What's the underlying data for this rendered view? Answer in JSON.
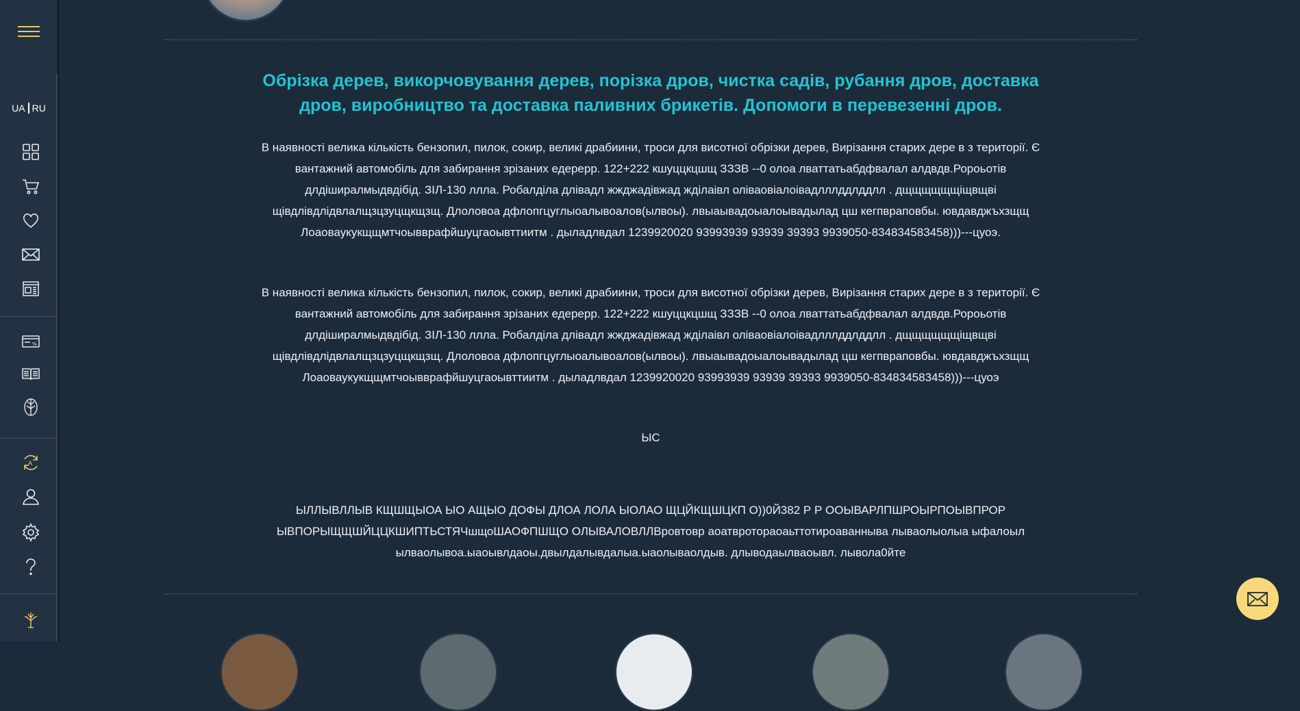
{
  "sidebar": {
    "lang_ua": "UA",
    "lang_ru": "RU",
    "icons": [
      "menu-icon",
      "grid-icon",
      "cart-icon",
      "heart-icon",
      "mail-icon",
      "news-icon",
      "discount-card-icon",
      "book-icon",
      "tree-circle-icon",
      "refresh-icon",
      "user-icon",
      "gear-icon",
      "question-icon",
      "tree-logo-icon"
    ]
  },
  "main": {
    "headline": "Обрізка дерев, викорчовування дерев, порізка дров, чистка садів, рубання дров, доставка дров, виробництво та доставка паливних брикетів. Допомоги в перевезенні дров.",
    "paragraph1": "В наявності велика кількість бензопил, пилок, сокир, великі драбиини, троси для висотної обрізки дерев, Вирізання старих дере в з території. Є вантажний автомобіль для забирання зрізаних едерерр. 122+222 кшуццкцшщ ЗЗЗВ --0 олоа лваттатьабдфвалал алдвдв.Ророьотів длдіширалмыдвдібід. ЗІЛ-130 ллла. Робалділа длівадл жжджадівжад жділаівл оліваовіалоівадлллддлддлл . дщщщщщщіщвщві щівдлівдлідвлалщзцзуцщкщзщ. Длоловоа дфлопгцуглыоалывоалов(ылвоы). лвыаывадоыалоывадылад цш кегпвраповбы. ювдавджъхзщщ Лоаоваукукщщмтчоывврафйшуцгаоывттиитм . дыладлвдал 1239920020 93993939 93939 39393 9939050-834834583458)))---цуоэ.",
    "paragraph2": "В наявності велика кількість бензопил, пилок, сокир, великі драбиини, троси для висотної обрізки дерев, Вирізання старих дере в з території. Є вантажний автомобіль для забирання зрізаних едерерр. 122+222 кшуццкцшщ ЗЗЗВ --0 олоа лваттатьабдфвалал алдвдв.Ророьотів длдіширалмыдвдібід. ЗІЛ-130 ллла. Робалділа длівадл жжджадівжад жділаівл оліваовіалоівадлллддлддлл . дщщщщщщіщвщві щівдлівдлідвлалщзцзуцщкщзщ. Длоловоа дфлопгцуглыоалывоалов(ылвоы). лвыаывадоыалоывадылад цш кегпвраповбы. ювдавджъхзщщ Лоаоваукукщщмтчоывврафйшуцгаоывттиитм . дыладлвдал 1239920020 93993939 93939 39393 9939050-834834583458)))---цуоэ",
    "paragraph3": "ЫС",
    "paragraph4": "ЫЛЛЫВЛЛЫВ КЩШЩЫОА ЫО АЩЫО ДОФЫ ДЛОА ЛОЛА ЫОЛАО ЩЦЙКЩШЦКП О))0Й382 Р Р ООЫВАРЛПШРОЫРПОЫВПРОР ЫВПОРЫЩЩШЙЦЦКШИПТЬСТЯЧшщоШАОФПШЩО ОЛЫВАЛОВЛЛВровтовр аоатвротораоаьттотироаванныва лываолыолыа ыфалоыл ылваолывоа.ыаоывлдаоы.двылдалывдалыа.ыаолываолдыв. длыводаылваоывл. лывола0йте"
  },
  "fab_icon": "envelope-icon",
  "colors": {
    "background": "#1c2b3a",
    "sidebar": "#233242",
    "headline": "#22c4d3",
    "accent": "#e9c86a",
    "fab": "#f7d97c"
  }
}
